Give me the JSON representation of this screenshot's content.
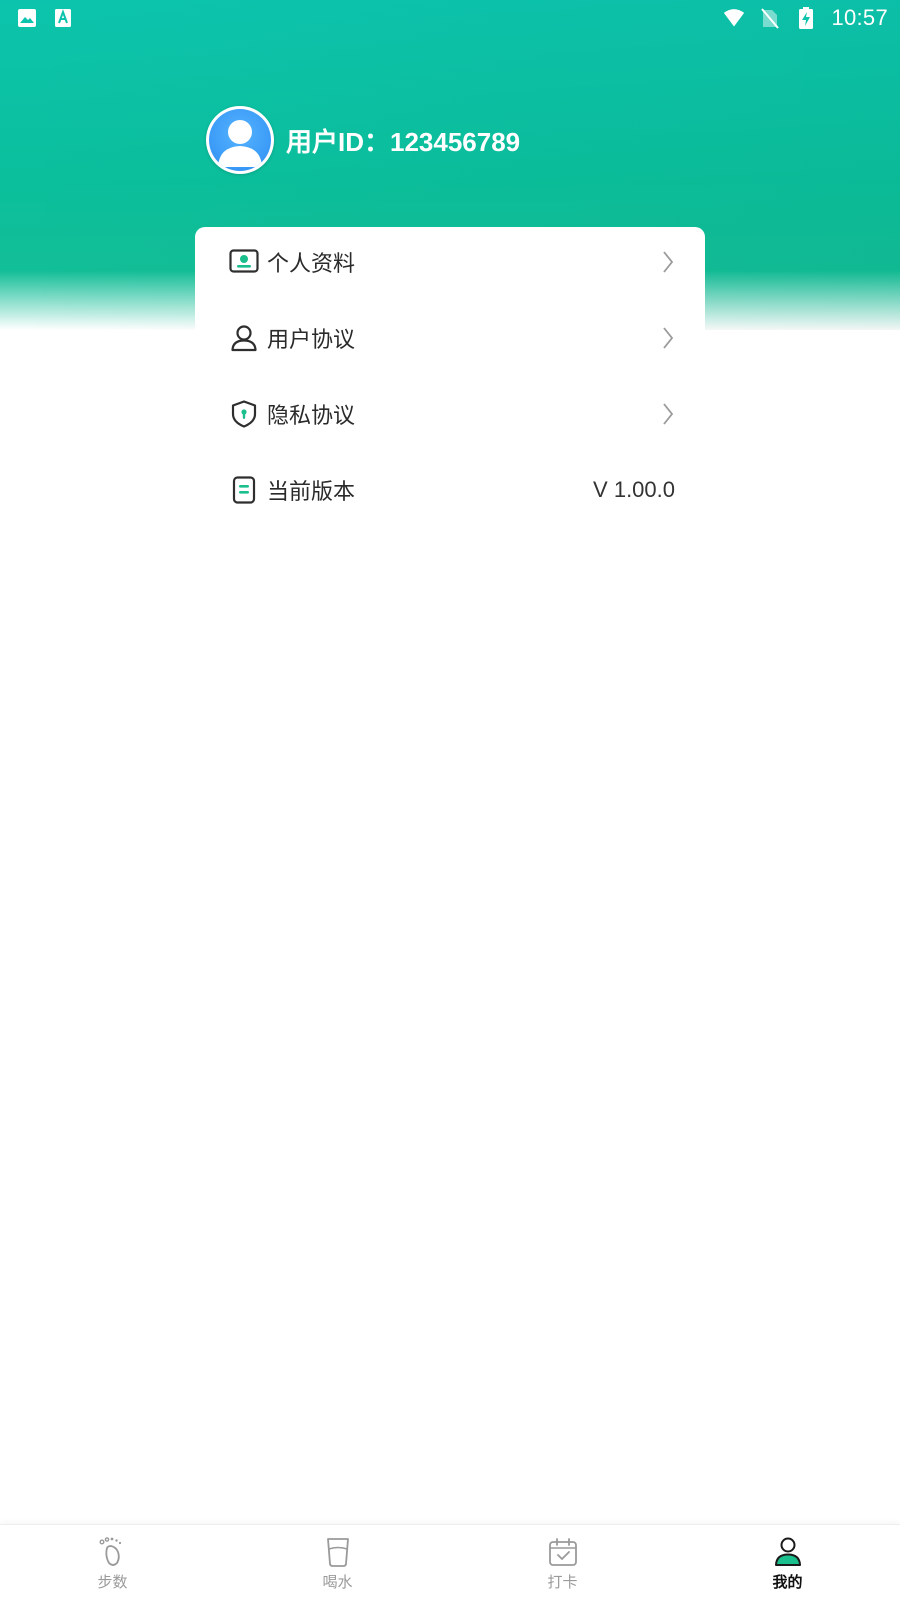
{
  "status_bar": {
    "time": "10:57",
    "left_icons": [
      "image-icon",
      "text-a-icon"
    ],
    "right_icons": [
      "wifi-icon",
      "no-sim-icon",
      "battery-charging-icon"
    ]
  },
  "profile": {
    "user_id_label": "用户ID：123456789"
  },
  "menu": {
    "items": [
      {
        "label": "个人资料",
        "icon": "profile-card-icon",
        "chevron": true
      },
      {
        "label": "用户协议",
        "icon": "user-outline-icon",
        "chevron": true
      },
      {
        "label": "隐私协议",
        "icon": "shield-lock-icon",
        "chevron": true
      },
      {
        "label": "当前版本",
        "icon": "document-icon",
        "value": "V 1.00.0"
      }
    ]
  },
  "bottom_nav": {
    "tabs": [
      {
        "label": "步数",
        "icon": "footprint-icon",
        "active": false
      },
      {
        "label": "喝水",
        "icon": "cup-icon",
        "active": false
      },
      {
        "label": "打卡",
        "icon": "calendar-check-icon",
        "active": false
      },
      {
        "label": "我的",
        "icon": "person-icon",
        "active": true
      }
    ]
  },
  "colors": {
    "accent": "#0bc0a3",
    "icon_green": "#1bbf8d",
    "text_primary": "#2a2a2a",
    "text_muted": "#9a9a9a"
  }
}
